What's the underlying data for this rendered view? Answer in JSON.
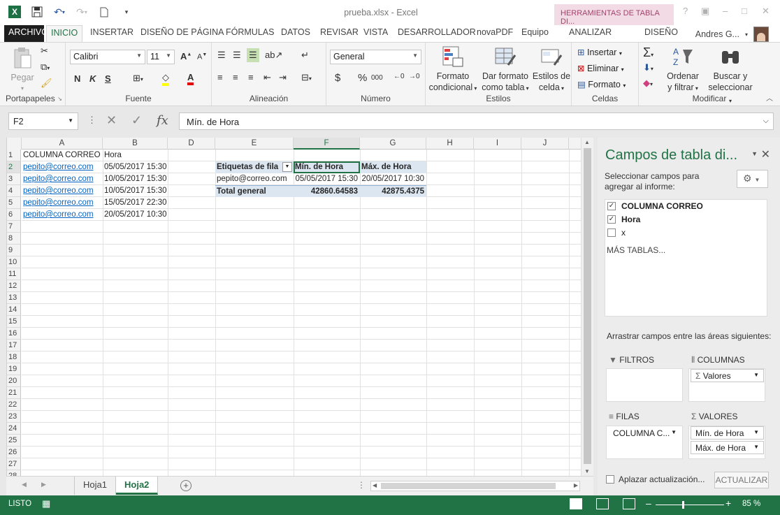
{
  "window": {
    "title": "prueba.xlsx - Excel",
    "context_tab_header": "HERRAMIENTAS DE TABLA DI...",
    "user": "Andres G...",
    "controls": [
      "?",
      "▣",
      "–",
      "□",
      "✕"
    ]
  },
  "ribbon_tabs": [
    "ARCHIVO",
    "INICIO",
    "INSERTAR",
    "DISEÑO DE PÁGINA",
    "FÓRMULAS",
    "DATOS",
    "REVISAR",
    "VISTA",
    "DESARROLLADOR",
    "novaPDF",
    "Equipo",
    "ANALIZAR",
    "DISEÑO"
  ],
  "ribbon": {
    "portapapeles": {
      "label": "Portapapeles",
      "pegar": "Pegar"
    },
    "fuente": {
      "label": "Fuente",
      "font": "Calibri",
      "size": "11",
      "bold": "N",
      "italic": "K",
      "underline": "S"
    },
    "alineacion": {
      "label": "Alineación"
    },
    "numero": {
      "label": "Número",
      "format": "General",
      "currency": "$",
      "percent": "%",
      "thousands": "000"
    },
    "estilos": {
      "label": "Estilos",
      "formato_condicional": [
        "Formato",
        "condicional"
      ],
      "dar_formato": [
        "Dar formato",
        "como tabla"
      ],
      "estilos_celda": [
        "Estilos de",
        "celda"
      ]
    },
    "celdas": {
      "label": "Celdas",
      "insertar": "Insertar",
      "eliminar": "Eliminar",
      "formato": "Formato"
    },
    "modificar": {
      "label": "Modificar",
      "ordenar": [
        "Ordenar",
        "y filtrar"
      ],
      "buscar": [
        "Buscar y",
        "seleccionar"
      ]
    }
  },
  "formula_bar": {
    "name_box": "F2",
    "formula": "Mín. de Hora",
    "fx": "fx"
  },
  "columns": [
    "A",
    "B",
    "D",
    "E",
    "F",
    "G",
    "H",
    "I",
    "J"
  ],
  "rows": [
    "1",
    "2",
    "3",
    "4",
    "5",
    "6",
    "7",
    "8",
    "9",
    "10",
    "11",
    "12",
    "13",
    "14",
    "15",
    "16",
    "17",
    "18",
    "19",
    "20",
    "21",
    "22",
    "23",
    "24",
    "25",
    "26",
    "27",
    "28"
  ],
  "cells": {
    "A1": "COLUMNA CORREO",
    "B1": "Hora",
    "A2": "pepito@correo.com",
    "B2": "05/05/2017 15:30",
    "A3": "pepito@correo.com",
    "B3": "10/05/2017 15:30",
    "A4": "pepito@correo.com",
    "B4": "10/05/2017 15:30",
    "A5": "pepito@correo.com",
    "B5": "15/05/2017 22:30",
    "A6": "pepito@correo.com",
    "B6": "20/05/2017 10:30",
    "E2": "Etiquetas de fila",
    "F2": "Mín. de Hora",
    "G2": "Máx. de Hora",
    "E3": "pepito@correo.com",
    "F3": "05/05/2017 15:30",
    "G3": "20/05/2017 10:30",
    "E4": "Total general",
    "F4": "42860.64583",
    "G4": "42875.4375"
  },
  "sheets": [
    "Hoja1",
    "Hoja2"
  ],
  "active_sheet": "Hoja2",
  "status": {
    "mode": "LISTO",
    "zoom": "85 %"
  },
  "pivot_pane": {
    "title": "Campos de tabla di...",
    "subtitle": "Seleccionar campos para agregar al informe:",
    "fields": [
      {
        "name": "COLUMNA CORREO",
        "checked": true
      },
      {
        "name": "Hora",
        "checked": true
      },
      {
        "name": "x",
        "checked": false
      }
    ],
    "more_tables": "MÁS TABLAS...",
    "drag_hint": "Arrastrar campos entre las áreas siguientes:",
    "areas": {
      "filtros": "FILTROS",
      "columnas": "COLUMNAS",
      "filas": "FILAS",
      "valores": "VALORES",
      "columnas_items": [
        "Valores"
      ],
      "filas_items": [
        "COLUMNA C..."
      ],
      "valores_items": [
        "Mín. de Hora",
        "Máx. de Hora"
      ]
    },
    "defer_label": "Aplazar actualización...",
    "update_button": "ACTUALIZAR"
  },
  "colors": {
    "excel_green": "#217346",
    "pivot_header": "#dce6f1",
    "hyperlink": "#0563c1"
  }
}
